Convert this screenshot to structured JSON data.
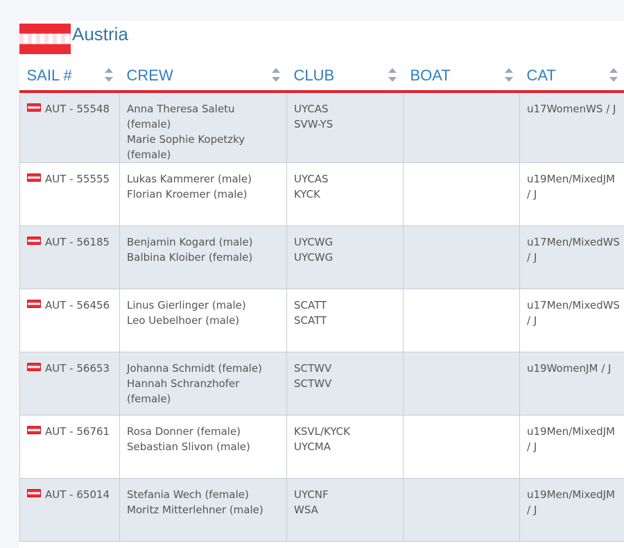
{
  "country": {
    "name": "Austria"
  },
  "colors": {
    "header_text": "#2f7fbf",
    "header_border": "#e3202a",
    "row_alt": "#e4e9f0"
  },
  "columns": [
    {
      "label": "SAIL #"
    },
    {
      "label": "CREW"
    },
    {
      "label": "CLUB"
    },
    {
      "label": "BOAT"
    },
    {
      "label": "CAT"
    }
  ],
  "rows": [
    {
      "sail": "AUT - 55548",
      "crew": [
        "Anna Theresa Saletu (female)",
        "Marie Sophie Kopetzky (female)"
      ],
      "club": [
        "UYCAS",
        "SVW-YS"
      ],
      "boat": "",
      "cat": "u17WomenWS / J"
    },
    {
      "sail": "AUT - 55555",
      "crew": [
        "Lukas Kammerer (male)",
        "Florian Kroemer (male)"
      ],
      "club": [
        "UYCAS",
        "KYCK"
      ],
      "boat": "",
      "cat": "u19Men/MixedJM / J"
    },
    {
      "sail": "AUT - 56185",
      "crew": [
        "Benjamin Kogard (male)",
        "Balbina Kloiber (female)"
      ],
      "club": [
        "UYCWG",
        "UYCWG"
      ],
      "boat": "",
      "cat": "u17Men/MixedWS / J"
    },
    {
      "sail": "AUT - 56456",
      "crew": [
        "Linus Gierlinger (male)",
        "Leo Uebelhoer (male)"
      ],
      "club": [
        "SCATT",
        "SCATT"
      ],
      "boat": "",
      "cat": "u17Men/MixedWS / J"
    },
    {
      "sail": "AUT - 56653",
      "crew": [
        "Johanna Schmidt (female)",
        "Hannah Schranzhofer (female)"
      ],
      "club": [
        "SCTWV",
        "SCTWV"
      ],
      "boat": "",
      "cat": "u19WomenJM / J"
    },
    {
      "sail": "AUT - 56761",
      "crew": [
        "Rosa Donner (female)",
        "Sebastian Slivon (male)"
      ],
      "club": [
        "KSVL/KYCK",
        "UYCMA"
      ],
      "boat": "",
      "cat": "u19Men/MixedJM / J"
    },
    {
      "sail": "AUT - 65014",
      "crew": [
        "Stefania Wech (female)",
        "Moritz Mitterlehner (male)"
      ],
      "club": [
        "UYCNF",
        "WSA"
      ],
      "boat": "",
      "cat": "u19Men/MixedJM / J"
    }
  ]
}
